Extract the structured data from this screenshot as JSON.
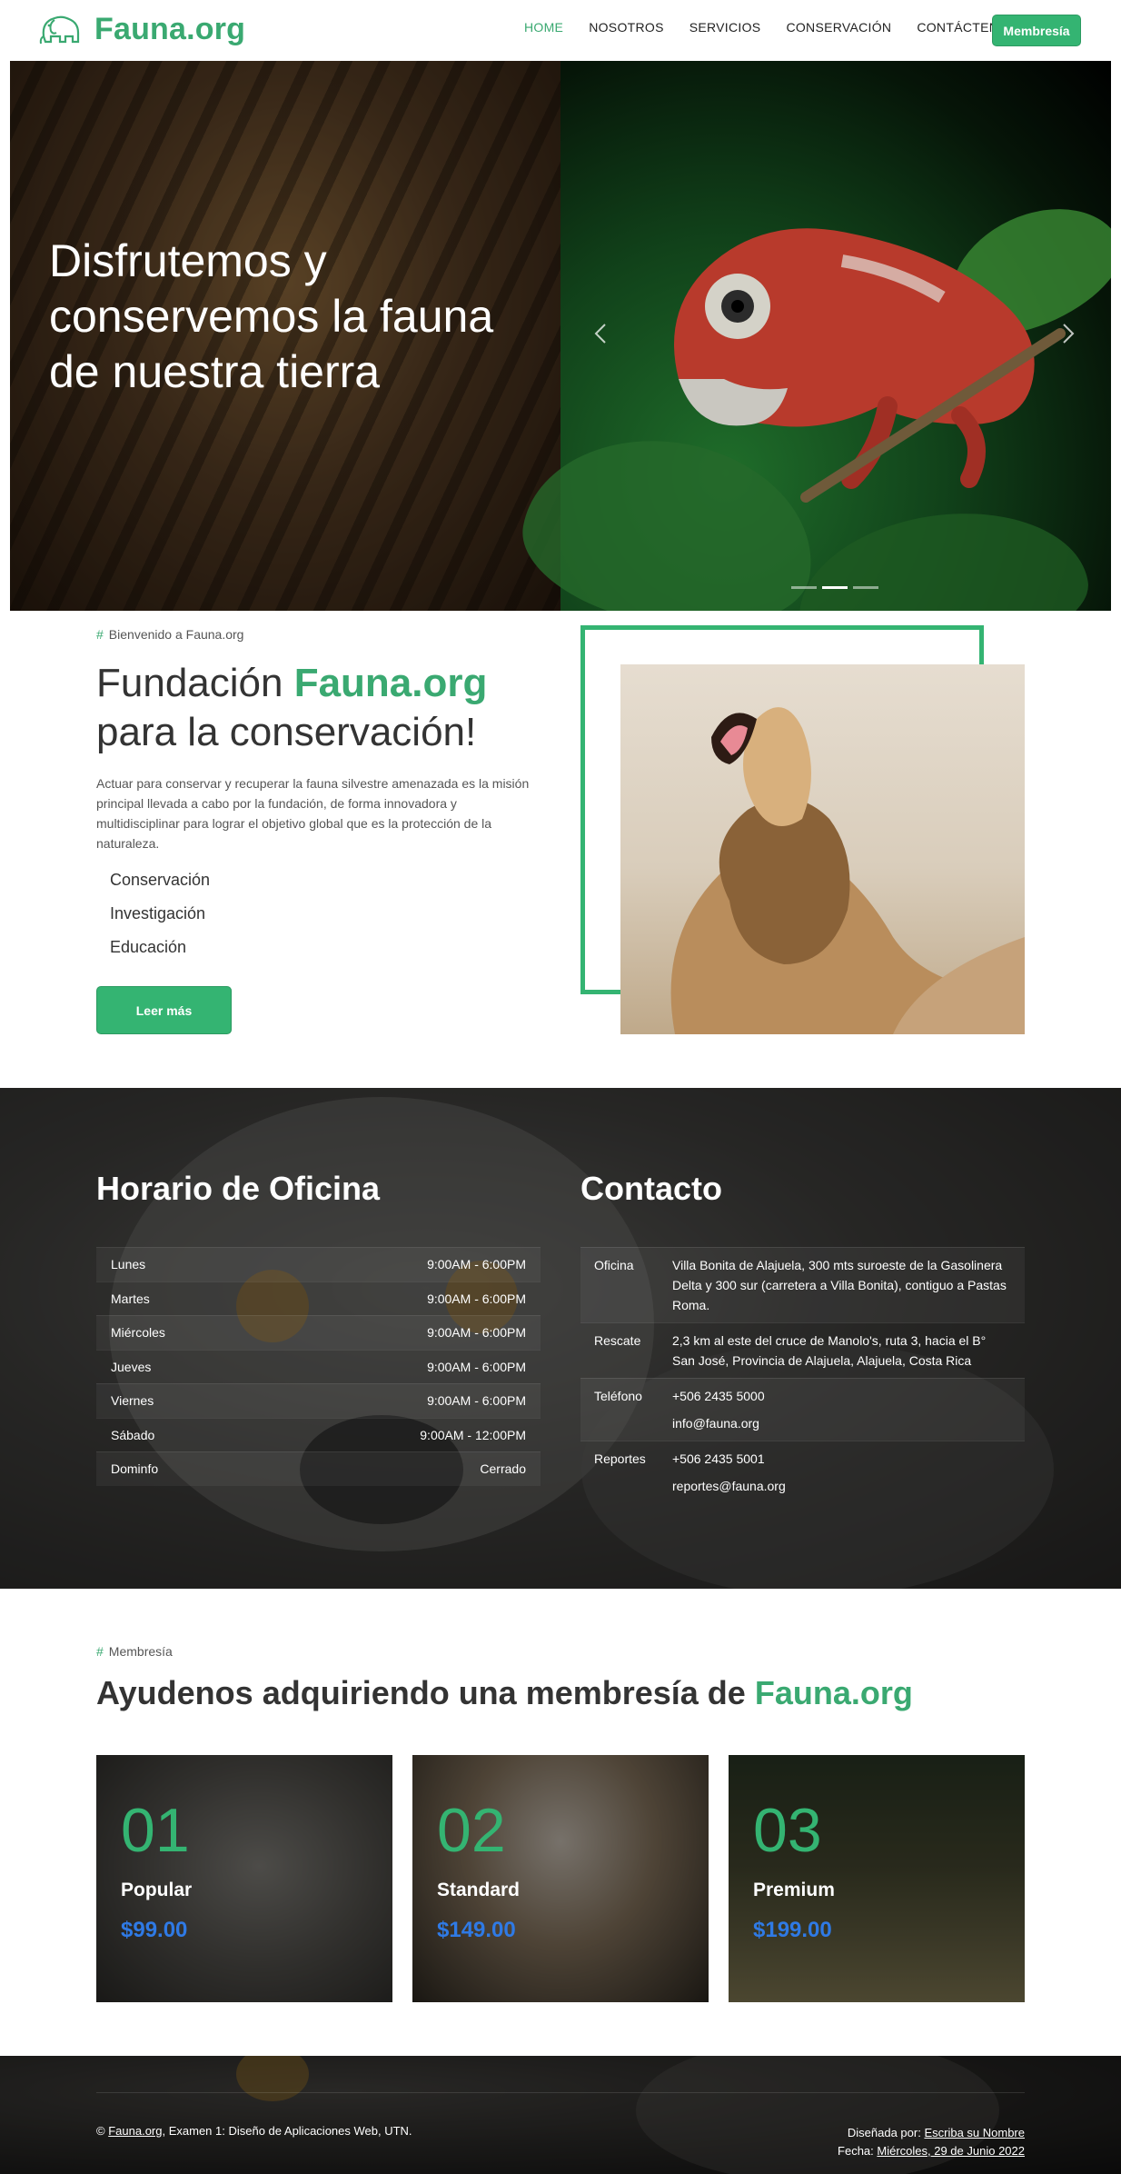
{
  "navbar": {
    "brand": "Fauna.org",
    "links": [
      "HOME",
      "NOSOTROS",
      "SERVICIOS",
      "CONSERVACIÓN",
      "CONTÁCTENOS"
    ],
    "cta": "Membresía"
  },
  "hero": {
    "title_line1": "Disfrutemos y",
    "title_line2": "conservemos la fauna",
    "title_line3": "de nuestra tierra"
  },
  "about": {
    "eyebrow": "Bienvenido a Fauna.org",
    "title_prefix": "Fundación ",
    "title_brand": "Fauna.org",
    "title_line2": "para la conservación!",
    "text": "Actuar para conservar y recuperar la fauna silvestre amenazada es la misión principal llevada a cabo por la fundación, de forma innovadora y multidisciplinar para lograr el objetivo global que es la protección de la naturaleza.",
    "items": [
      "Conservación",
      "Investigación",
      "Educación"
    ],
    "button": "Leer más"
  },
  "schedule": {
    "title": "Horario de Oficina",
    "rows": [
      {
        "day": "Lunes",
        "hours": "9:00AM - 6:00PM"
      },
      {
        "day": "Martes",
        "hours": "9:00AM - 6:00PM"
      },
      {
        "day": "Miércoles",
        "hours": "9:00AM - 6:00PM"
      },
      {
        "day": "Jueves",
        "hours": "9:00AM - 6:00PM"
      },
      {
        "day": "Viernes",
        "hours": "9:00AM - 6:00PM"
      },
      {
        "day": "Sábado",
        "hours": "9:00AM - 12:00PM"
      },
      {
        "day": "Dominfo",
        "hours": "Cerrado"
      }
    ]
  },
  "contact": {
    "title": "Contacto",
    "office_label": "Oficina",
    "office_value": "Villa Bonita de Alajuela, 300 mts suroeste de la Gasolinera Delta y 300 sur (carretera a Villa Bonita), contiguo a Pastas Roma.",
    "rescue_label": "Rescate",
    "rescue_value": "2,3 km al este del cruce de Manolo's, ruta 3, hacia el B° San José, Provincia de Alajuela, Alajuela, Costa Rica",
    "phone_label": "Teléfono",
    "phone_value": "+506 2435 5000",
    "phone_email": "info@fauna.org",
    "reports_label": "Reportes",
    "reports_value": "+506 2435 5001",
    "reports_email": "reportes@fauna.org"
  },
  "membership": {
    "eyebrow": "Membresía",
    "title_prefix": "Ayudenos adquiriendo una membresía de ",
    "title_brand": "Fauna.org",
    "cards": [
      {
        "num": "01",
        "name": "Popular",
        "price": "$99.00"
      },
      {
        "num": "02",
        "name": "Standard",
        "price": "$149.00"
      },
      {
        "num": "03",
        "name": "Premium",
        "price": "$199.00"
      }
    ]
  },
  "footer": {
    "copyright": "©",
    "site_link": "Fauna.org",
    "left_text": ", Examen 1: Diseño de Aplicaciones Web, UTN.",
    "designed_by": "Diseñada por: ",
    "designer_link": "Escriba su Nombre",
    "date_label": "Fecha: ",
    "date_link": "Miércoles, 29 de Junio 2022"
  },
  "colors": {
    "accent": "#34b472",
    "brand_text": "#3aa971",
    "price": "#2f7ae5"
  },
  "icons": {
    "brand": "elephant-logo-icon",
    "prev": "chevron-left-icon",
    "next": "chevron-right-icon"
  }
}
